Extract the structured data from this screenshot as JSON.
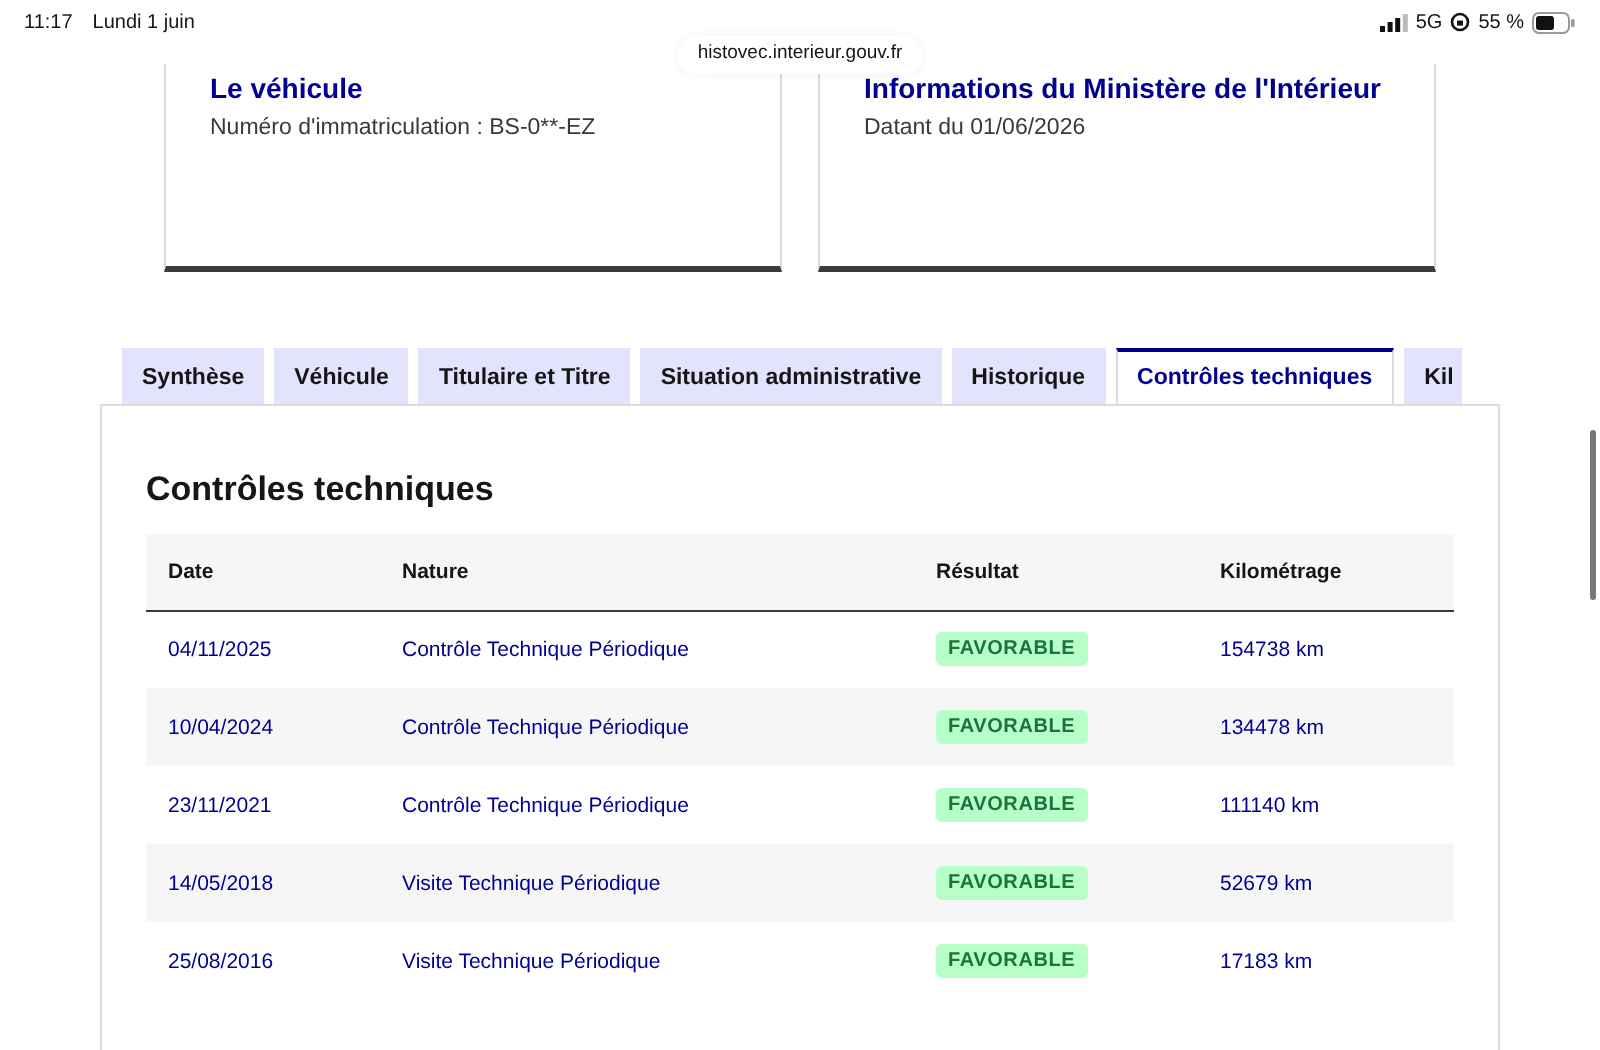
{
  "status_bar": {
    "time": "11:17",
    "date": "Lundi 1 juin",
    "network": "5G",
    "battery": "55 %"
  },
  "address_bar": {
    "url": "histovec.interieur.gouv.fr"
  },
  "cards": [
    {
      "title": "Le véhicule",
      "text": "Numéro d'immatriculation : BS-0**-EZ"
    },
    {
      "title": "Informations du Ministère de l'Intérieur",
      "text": "Datant du 01/06/2026"
    }
  ],
  "tabs": [
    {
      "label": "Synthèse",
      "selected": false
    },
    {
      "label": "Véhicule",
      "selected": false
    },
    {
      "label": "Titulaire et Titre",
      "selected": false
    },
    {
      "label": "Situation administrative",
      "selected": false
    },
    {
      "label": "Historique",
      "selected": false
    },
    {
      "label": "Contrôles techniques",
      "selected": true
    },
    {
      "label": "Kil",
      "selected": false
    }
  ],
  "section": {
    "title": "Contrôles techniques"
  },
  "table": {
    "columns": [
      "Date",
      "Nature",
      "Résultat",
      "Kilométrage"
    ],
    "rows": [
      {
        "date": "04/11/2025",
        "nature": "Contrôle Technique Périodique",
        "result": {
          "label": "FAVORABLE",
          "kind": "favorable"
        },
        "mileage": "154738 km"
      },
      {
        "date": "10/04/2024",
        "nature": "Contrôle Technique Périodique",
        "result": {
          "label": "FAVORABLE",
          "kind": "favorable"
        },
        "mileage": "134478 km"
      },
      {
        "date": "23/11/2021",
        "nature": "Contrôle Technique Périodique",
        "result": {
          "label": "FAVORABLE",
          "kind": "favorable"
        },
        "mileage": "111140 km"
      },
      {
        "date": "14/05/2018",
        "nature": "Visite Technique Périodique",
        "result": {
          "label": "FAVORABLE",
          "kind": "favorable"
        },
        "mileage": "52679 km"
      },
      {
        "date": "25/08/2016",
        "nature": "Visite Technique Périodique",
        "result": {
          "label": "FAVORABLE",
          "kind": "favorable"
        },
        "mileage": "17183 km"
      }
    ]
  }
}
